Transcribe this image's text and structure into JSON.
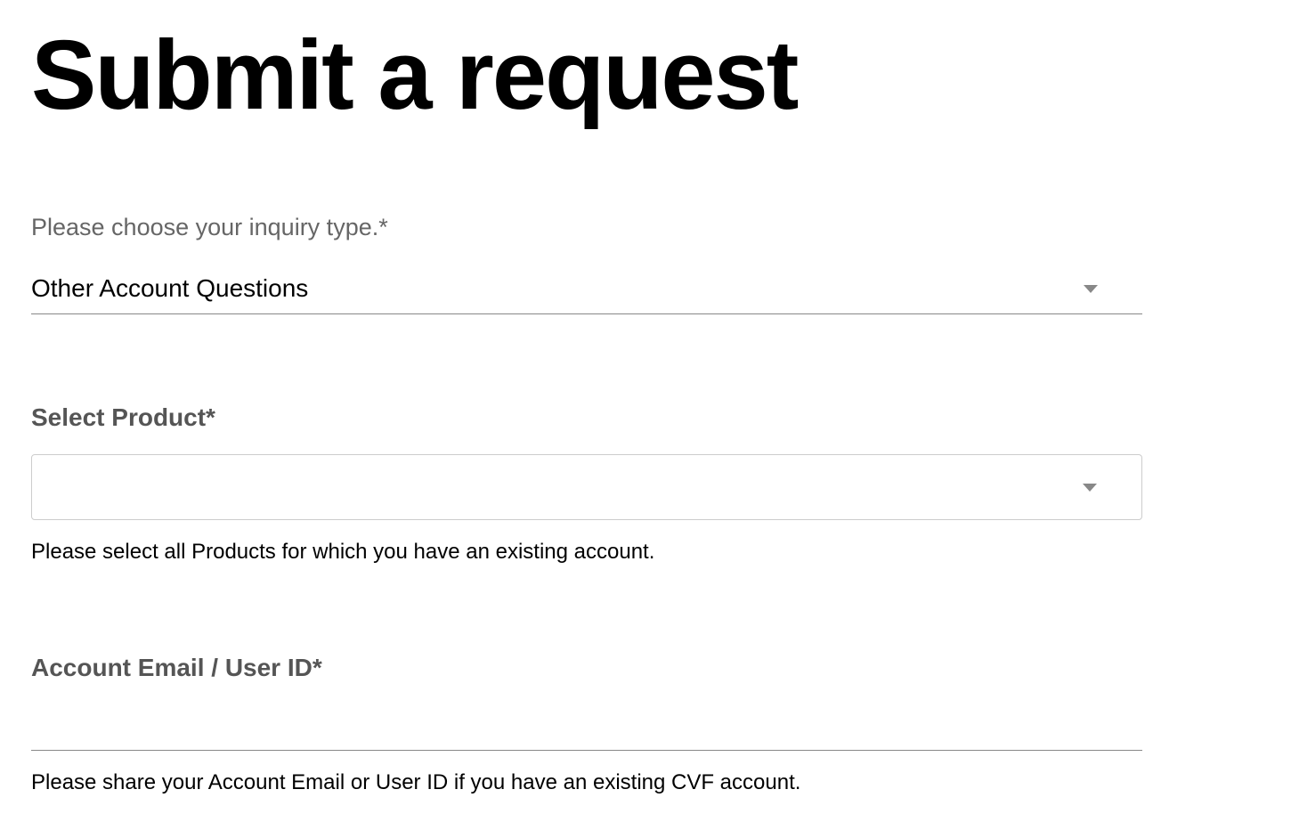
{
  "page": {
    "title": "Submit a request"
  },
  "form": {
    "inquiry_type": {
      "label": "Please choose your inquiry type.*",
      "selected": "Other Account Questions"
    },
    "select_product": {
      "label": "Select Product*",
      "selected": "",
      "help_text": "Please select all Products for which you have an existing account."
    },
    "account_email": {
      "label": "Account Email / User ID*",
      "value": "",
      "help_text": "Please share your Account Email or User ID if you have an existing CVF account."
    }
  }
}
